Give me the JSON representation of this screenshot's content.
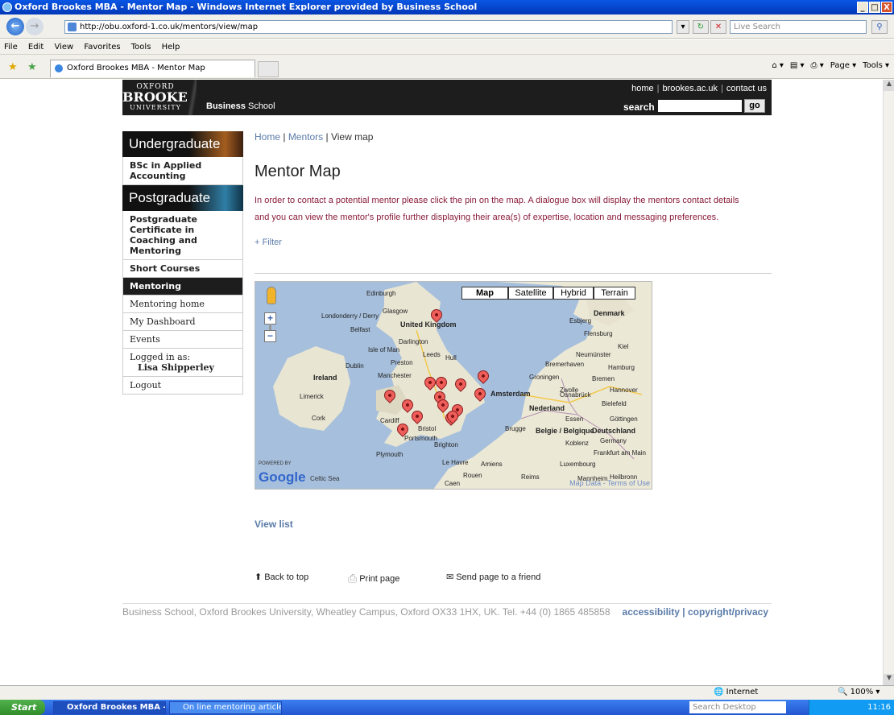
{
  "window": {
    "title": "Oxford Brookes MBA - Mentor Map - Windows Internet Explorer provided by Business School",
    "controls": [
      "_",
      "□",
      "X"
    ]
  },
  "addressbar": {
    "url": "http://obu.oxford-1.co.uk/mentors/view/map",
    "search_placeholder": "Live Search"
  },
  "menubar": [
    "File",
    "Edit",
    "View",
    "Favorites",
    "Tools",
    "Help"
  ],
  "tab": {
    "title": "Oxford Brookes MBA - Mentor Map"
  },
  "toolbar": {
    "page": "Page",
    "tools": "Tools"
  },
  "header": {
    "logo_line1": "OXFORD",
    "logo_line2": "BROOKES",
    "logo_line3": "UNIVERSITY",
    "school_bold": "Business",
    "school_rest": " School",
    "links": [
      "home",
      "brookes.ac.uk",
      "contact us"
    ],
    "search_label": "search",
    "go": "go"
  },
  "sidebar": {
    "undergraduate": "Undergraduate",
    "ug_items": [
      "BSc in Applied Accounting"
    ],
    "postgraduate": "Postgraduate",
    "pg_items": [
      "Postgraduate Certificate in Coaching and Mentoring",
      "Short Courses"
    ],
    "selected": "Mentoring",
    "sub_items": [
      "Mentoring home",
      "My Dashboard",
      "Events"
    ],
    "logged_label": "Logged in as:",
    "user": "Lisa Shipperley",
    "logout": "Logout"
  },
  "main": {
    "crumb_home": "Home",
    "crumb_mentors": "Mentors",
    "crumb_current": "View map",
    "title": "Mentor Map",
    "intro": "In order to contact a potential mentor please click the pin on the map. A dialogue box will display the mentors contact details and you can view the mentor's profile further displaying their area(s) of expertise, location and messaging preferences.",
    "filter": "+ Filter",
    "view_list": "View list",
    "back_to_top": "Back to top",
    "print_page": "Print page",
    "send_page": "Send page to a friend"
  },
  "map": {
    "types": [
      "Map",
      "Satellite",
      "Hybrid",
      "Terrain"
    ],
    "powered_by": "POWERED BY",
    "google": "Google",
    "sea": "Celtic Sea",
    "map_data": "Map Data - Terms of Use",
    "labels": [
      {
        "t": "Edinburgh",
        "bold": false
      },
      {
        "t": "Glasgow",
        "bold": false
      },
      {
        "t": "Londonderry / Derry",
        "bold": false
      },
      {
        "t": "United Kingdom",
        "bold": true
      },
      {
        "t": "Belfast",
        "bold": false
      },
      {
        "t": "Darlington",
        "bold": false
      },
      {
        "t": "Isle of Man",
        "bold": false
      },
      {
        "t": "Leeds",
        "bold": false
      },
      {
        "t": "Hull",
        "bold": false
      },
      {
        "t": "Preston",
        "bold": false
      },
      {
        "t": "Dublin",
        "bold": false
      },
      {
        "t": "Ireland",
        "bold": true
      },
      {
        "t": "Manchester",
        "bold": false
      },
      {
        "t": "Limerick",
        "bold": false
      },
      {
        "t": "Cork",
        "bold": false
      },
      {
        "t": "Cardiff",
        "bold": false
      },
      {
        "t": "Bristol",
        "bold": false
      },
      {
        "t": "Portsmouth",
        "bold": false
      },
      {
        "t": "Brighton",
        "bold": false
      },
      {
        "t": "Plymouth",
        "bold": false
      },
      {
        "t": "Le Havre",
        "bold": false
      },
      {
        "t": "Amiens",
        "bold": false
      },
      {
        "t": "Rouen",
        "bold": false
      },
      {
        "t": "Caen",
        "bold": false
      },
      {
        "t": "Reims",
        "bold": false
      },
      {
        "t": "Amsterdam",
        "bold": false
      },
      {
        "t": "Groningen",
        "bold": false
      },
      {
        "t": "Zwolle",
        "bold": false
      },
      {
        "t": "Nederland",
        "bold": true
      },
      {
        "t": "Brugge",
        "bold": false
      },
      {
        "t": "Belgie / Belgique",
        "bold": true
      },
      {
        "t": "Luxembourg",
        "bold": false
      },
      {
        "t": "Denmark",
        "bold": true
      },
      {
        "t": "Esbjerg",
        "bold": false
      },
      {
        "t": "Flensburg",
        "bold": false
      },
      {
        "t": "Kiel",
        "bold": false
      },
      {
        "t": "Neumünster",
        "bold": false
      },
      {
        "t": "Bremerhaven",
        "bold": false
      },
      {
        "t": "Hamburg",
        "bold": false
      },
      {
        "t": "Bremen",
        "bold": false
      },
      {
        "t": "Hannover",
        "bold": false
      },
      {
        "t": "Osnabrück",
        "bold": false
      },
      {
        "t": "Bielefeld",
        "bold": false
      },
      {
        "t": "Essen",
        "bold": false
      },
      {
        "t": "Göttingen",
        "bold": false
      },
      {
        "t": "Deutschland",
        "bold": true
      },
      {
        "t": "Germany",
        "bold": false
      },
      {
        "t": "Koblenz",
        "bold": false
      },
      {
        "t": "Frankfurt am Main",
        "bold": false
      },
      {
        "t": "Mannheim",
        "bold": false
      },
      {
        "t": "Heilbronn",
        "bold": false
      }
    ]
  },
  "footer": {
    "address": "Business School, Oxford Brookes University, Wheatley Campus, Oxford OX33 1HX, UK. Tel. +44 (0) 1865 485858",
    "accessibility": "accessibility",
    "copyright": "copyright/privacy"
  },
  "statusbar": {
    "zone": "Internet",
    "zoom": "100%"
  },
  "taskbar": {
    "start": "Start",
    "tasks": [
      "Oxford Brookes MBA -...",
      "On line mentoring article...."
    ],
    "search": "Search Desktop",
    "time": "11:16"
  }
}
